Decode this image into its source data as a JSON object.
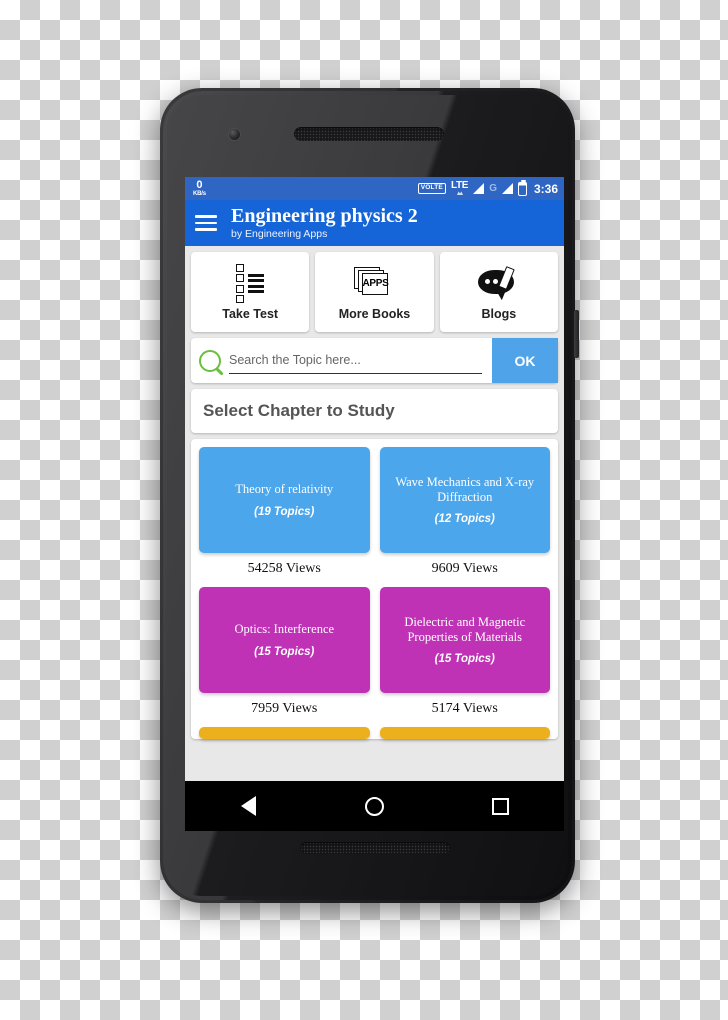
{
  "status_bar": {
    "net_speed_value": "0",
    "net_speed_unit": "KB/s",
    "volte_label": "VOLTE",
    "lte_label": "LTE",
    "lte_arrows": "▴▴",
    "g_label": "G",
    "clock": "3:36"
  },
  "app_bar": {
    "menu_icon": "hamburger-icon",
    "title": "Engineering physics 2",
    "subtitle": "by Engineering Apps"
  },
  "quick_actions": [
    {
      "label": "Take Test",
      "icon": "checklist-icon"
    },
    {
      "label": "More Books",
      "icon": "apps-stack-icon",
      "icon_text": "APPS"
    },
    {
      "label": "Blogs",
      "icon": "blog-pencil-icon"
    }
  ],
  "search": {
    "icon": "search-icon",
    "value": "",
    "placeholder": "Search the Topic here...",
    "button_label": "OK"
  },
  "chapter_section": {
    "header": "Select Chapter to Study",
    "rows": [
      {
        "partial": false,
        "cells": [
          {
            "title": "Theory of relativity",
            "topics": "(19 Topics)",
            "views": "54258 Views",
            "color": "#4ca6ec"
          },
          {
            "title": "Wave Mechanics and X-ray Diffraction",
            "topics": "(12 Topics)",
            "views": "9609 Views",
            "color": "#4ca6ec"
          }
        ]
      },
      {
        "partial": false,
        "cells": [
          {
            "title": "Optics: Interference",
            "topics": "(15 Topics)",
            "views": "7959 Views",
            "color": "#bf31b5"
          },
          {
            "title": "Dielectric and Magnetic Properties of Materials",
            "topics": "(15 Topics)",
            "views": "5174 Views",
            "color": "#bf31b5"
          }
        ]
      },
      {
        "partial": true,
        "cells": [
          {
            "title": "",
            "topics": "",
            "views": "",
            "color": "#edb01d"
          },
          {
            "title": "",
            "topics": "",
            "views": "",
            "color": "#edb01d"
          }
        ]
      }
    ]
  },
  "nav_bar": {
    "back": "back-triangle-icon",
    "home": "home-circle-icon",
    "recents": "recents-square-icon"
  },
  "theme": {
    "status_bar_color": "#2f66c4",
    "app_bar_color": "#1565d8",
    "accent_blue": "#4fa3e8",
    "search_icon_green": "#6abf3f",
    "tile_blue": "#4ca6ec",
    "tile_magenta": "#bf31b5",
    "tile_amber": "#edb01d"
  }
}
